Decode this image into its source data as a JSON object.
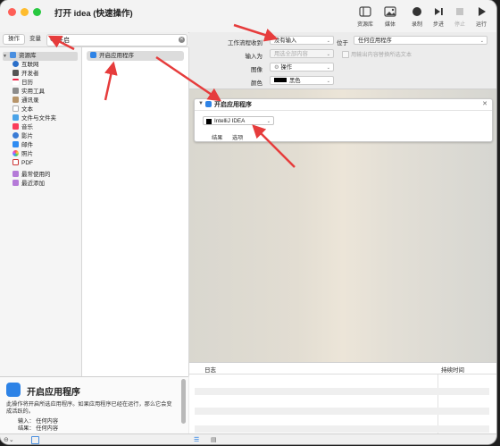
{
  "window": {
    "title": "打开 idea (快速操作)"
  },
  "toolbar": {
    "library": "资源库",
    "media": "媒体",
    "record": "录制",
    "step": "步进",
    "stop": "停止",
    "run": "运行"
  },
  "left": {
    "tabs": {
      "actions": "操作",
      "variables": "变量"
    },
    "search": {
      "value": "开启"
    },
    "tree": {
      "root": "资源库",
      "items": [
        "互联网",
        "开发者",
        "日历",
        "实用工具",
        "通讯录",
        "文本",
        "文件与文件夹",
        "音乐",
        "影片",
        "邮件",
        "照片",
        "PDF"
      ],
      "smart": [
        "最常使用的",
        "最近添加"
      ]
    },
    "actions": [
      "开启应用程序"
    ]
  },
  "description": {
    "title": "开启应用程序",
    "text": "此操作将开启所选应用程序。如果应用程序已经在运行，那么它会变成活跃的。",
    "input": "输入： 任何内容",
    "result": "结果： 任何内容"
  },
  "config": {
    "receives_label": "工作流程收到",
    "receives_value": "没有输入",
    "in_label": "位于",
    "in_value": "任何应用程序",
    "input_is_label": "输入为",
    "input_is_value": "用选全部内容",
    "replace_label": "用输出内容替换所选文本",
    "image_label": "图像",
    "image_value": "操作",
    "color_label": "颜色",
    "color_value": "黑色"
  },
  "workflow": {
    "action_title": "开启应用程序",
    "app": "IntelliJ IDEA",
    "tab_results": "结果",
    "tab_options": "选项"
  },
  "log": {
    "col_log": "日志",
    "col_duration": "持续时间"
  }
}
